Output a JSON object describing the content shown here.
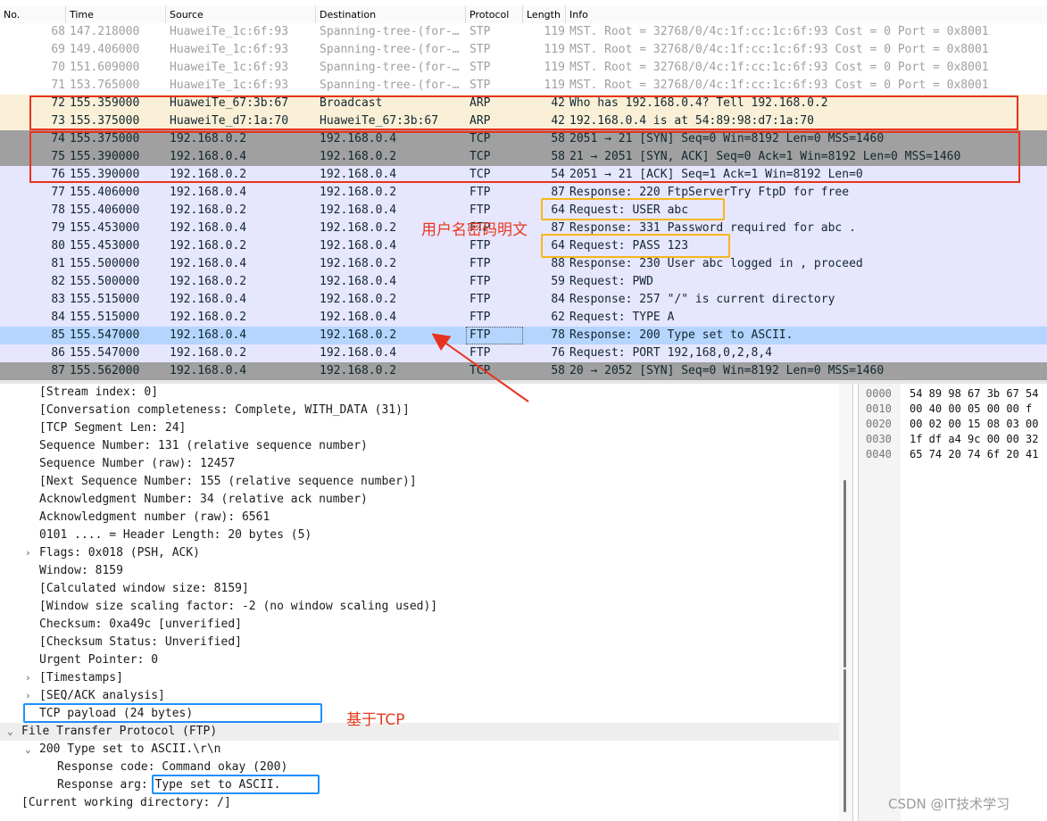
{
  "packet_list": {
    "columns": [
      "No.",
      "Time",
      "Source",
      "Destination",
      "Protocol",
      "Length",
      "Info"
    ],
    "rows": [
      {
        "no": "68",
        "time": "147.218000",
        "src": "HuaweiTe_1c:6f:93",
        "dst": "Spanning-tree-(for-…",
        "proto": "STP",
        "len": "119",
        "info": "MST. Root = 32768/0/4c:1f:cc:1c:6f:93  Cost = 0  Port = 0x8001",
        "style": "stp"
      },
      {
        "no": "69",
        "time": "149.406000",
        "src": "HuaweiTe_1c:6f:93",
        "dst": "Spanning-tree-(for-…",
        "proto": "STP",
        "len": "119",
        "info": "MST. Root = 32768/0/4c:1f:cc:1c:6f:93  Cost = 0  Port = 0x8001",
        "style": "stp"
      },
      {
        "no": "70",
        "time": "151.609000",
        "src": "HuaweiTe_1c:6f:93",
        "dst": "Spanning-tree-(for-…",
        "proto": "STP",
        "len": "119",
        "info": "MST. Root = 32768/0/4c:1f:cc:1c:6f:93  Cost = 0  Port = 0x8001",
        "style": "stp"
      },
      {
        "no": "71",
        "time": "153.765000",
        "src": "HuaweiTe_1c:6f:93",
        "dst": "Spanning-tree-(for-…",
        "proto": "STP",
        "len": "119",
        "info": "MST. Root = 32768/0/4c:1f:cc:1c:6f:93  Cost = 0  Port = 0x8001",
        "style": "stp"
      },
      {
        "no": "72",
        "time": "155.359000",
        "src": "HuaweiTe_67:3b:67",
        "dst": "Broadcast",
        "proto": "ARP",
        "len": "42",
        "info": "Who has 192.168.0.4? Tell 192.168.0.2",
        "style": "arp"
      },
      {
        "no": "73",
        "time": "155.375000",
        "src": "HuaweiTe_d7:1a:70",
        "dst": "HuaweiTe_67:3b:67",
        "proto": "ARP",
        "len": "42",
        "info": "192.168.0.4 is at 54:89:98:d7:1a:70",
        "style": "arp"
      },
      {
        "no": "74",
        "time": "155.375000",
        "src": "192.168.0.2",
        "dst": "192.168.0.4",
        "proto": "TCP",
        "len": "58",
        "info": "2051 → 21 [SYN] Seq=0 Win=8192 Len=0 MSS=1460",
        "style": "tcpdark"
      },
      {
        "no": "75",
        "time": "155.390000",
        "src": "192.168.0.4",
        "dst": "192.168.0.2",
        "proto": "TCP",
        "len": "58",
        "info": "21 → 2051 [SYN, ACK] Seq=0 Ack=1 Win=8192 Len=0 MSS=1460",
        "style": "tcpdark"
      },
      {
        "no": "76",
        "time": "155.390000",
        "src": "192.168.0.2",
        "dst": "192.168.0.4",
        "proto": "TCP",
        "len": "54",
        "info": "2051 → 21 [ACK] Seq=1 Ack=1 Win=8192 Len=0",
        "style": "tcp"
      },
      {
        "no": "77",
        "time": "155.406000",
        "src": "192.168.0.4",
        "dst": "192.168.0.2",
        "proto": "FTP",
        "len": "87",
        "info": "Response: 220 FtpServerTry FtpD for free",
        "style": "ftp"
      },
      {
        "no": "78",
        "time": "155.406000",
        "src": "192.168.0.2",
        "dst": "192.168.0.4",
        "proto": "FTP",
        "len": "64",
        "info": "Request: USER abc",
        "style": "ftp"
      },
      {
        "no": "79",
        "time": "155.453000",
        "src": "192.168.0.4",
        "dst": "192.168.0.2",
        "proto": "FTP",
        "len": "87",
        "info": "Response: 331 Password required for abc .",
        "style": "ftp"
      },
      {
        "no": "80",
        "time": "155.453000",
        "src": "192.168.0.2",
        "dst": "192.168.0.4",
        "proto": "FTP",
        "len": "64",
        "info": "Request: PASS 123",
        "style": "ftp"
      },
      {
        "no": "81",
        "time": "155.500000",
        "src": "192.168.0.4",
        "dst": "192.168.0.2",
        "proto": "FTP",
        "len": "88",
        "info": "Response: 230 User abc logged in , proceed",
        "style": "ftp"
      },
      {
        "no": "82",
        "time": "155.500000",
        "src": "192.168.0.2",
        "dst": "192.168.0.4",
        "proto": "FTP",
        "len": "59",
        "info": "Request: PWD",
        "style": "ftp"
      },
      {
        "no": "83",
        "time": "155.515000",
        "src": "192.168.0.4",
        "dst": "192.168.0.2",
        "proto": "FTP",
        "len": "84",
        "info": "Response: 257 \"/\" is current directory",
        "style": "ftp"
      },
      {
        "no": "84",
        "time": "155.515000",
        "src": "192.168.0.2",
        "dst": "192.168.0.4",
        "proto": "FTP",
        "len": "62",
        "info": "Request: TYPE A",
        "style": "ftp"
      },
      {
        "no": "85",
        "time": "155.547000",
        "src": "192.168.0.4",
        "dst": "192.168.0.2",
        "proto": "FTP",
        "len": "78",
        "info": "Response: 200 Type set to ASCII.",
        "style": "sel"
      },
      {
        "no": "86",
        "time": "155.547000",
        "src": "192.168.0.2",
        "dst": "192.168.0.4",
        "proto": "FTP",
        "len": "76",
        "info": "Request: PORT 192,168,0,2,8,4",
        "style": "ftp"
      },
      {
        "no": "87",
        "time": "155.562000",
        "src": "192.168.0.4",
        "dst": "192.168.0.2",
        "proto": "TCP",
        "len": "58",
        "info": "20 → 2052 [SYN] Seq=0 Win=8192 Len=0 MSS=1460",
        "style": "tcpdark"
      }
    ]
  },
  "annotations": {
    "credentials_note": "用户名密码明文",
    "tcp_note": "基于TCP"
  },
  "details": {
    "lines": [
      {
        "indent": 1,
        "expander": "",
        "text": "[Stream index: 0]"
      },
      {
        "indent": 1,
        "expander": "",
        "text": "[Conversation completeness: Complete, WITH_DATA (31)]"
      },
      {
        "indent": 1,
        "expander": "",
        "text": "[TCP Segment Len: 24]"
      },
      {
        "indent": 1,
        "expander": "",
        "text": "Sequence Number: 131    (relative sequence number)"
      },
      {
        "indent": 1,
        "expander": "",
        "text": "Sequence Number (raw): 12457"
      },
      {
        "indent": 1,
        "expander": "",
        "text": "[Next Sequence Number: 155    (relative sequence number)]"
      },
      {
        "indent": 1,
        "expander": "",
        "text": "Acknowledgment Number: 34    (relative ack number)"
      },
      {
        "indent": 1,
        "expander": "",
        "text": "Acknowledgment number (raw): 6561"
      },
      {
        "indent": 1,
        "expander": "",
        "text": "0101 .... = Header Length: 20 bytes (5)"
      },
      {
        "indent": 1,
        "expander": "›",
        "text": "Flags: 0x018 (PSH, ACK)"
      },
      {
        "indent": 1,
        "expander": "",
        "text": "Window: 8159"
      },
      {
        "indent": 1,
        "expander": "",
        "text": "[Calculated window size: 8159]"
      },
      {
        "indent": 1,
        "expander": "",
        "text": "[Window size scaling factor: -2 (no window scaling used)]"
      },
      {
        "indent": 1,
        "expander": "",
        "text": "Checksum: 0xa49c [unverified]"
      },
      {
        "indent": 1,
        "expander": "",
        "text": "[Checksum Status: Unverified]"
      },
      {
        "indent": 1,
        "expander": "",
        "text": "Urgent Pointer: 0"
      },
      {
        "indent": 1,
        "expander": "›",
        "text": "[Timestamps]"
      },
      {
        "indent": 1,
        "expander": "›",
        "text": "[SEQ/ACK analysis]"
      },
      {
        "indent": 1,
        "expander": "",
        "text": "TCP payload (24 bytes)"
      },
      {
        "indent": 0,
        "expander": "⌄",
        "text": "File Transfer Protocol (FTP)",
        "highlight": true
      },
      {
        "indent": 1,
        "expander": "⌄",
        "text": "200 Type set to ASCII.\\r\\n"
      },
      {
        "indent": 2,
        "expander": "",
        "text": "Response code: Command okay (200)"
      },
      {
        "indent": 2,
        "expander": "",
        "text": "Response arg: Type set to ASCII."
      },
      {
        "indent": 0,
        "expander": "",
        "text": "[Current working directory: /]"
      }
    ]
  },
  "bytes": {
    "lines": [
      {
        "off": "0000",
        "hex": "54 89 98 67 3b 67 54"
      },
      {
        "off": "0010",
        "hex": "00 40 00 05 00 00 f"
      },
      {
        "off": "0020",
        "hex": "00 02 00 15 08 03 00"
      },
      {
        "off": "0030",
        "hex": "1f df a4 9c 00 00 32"
      },
      {
        "off": "0040",
        "hex": "65 74 20 74 6f 20 41"
      }
    ]
  },
  "watermark": "CSDN @IT技术学习",
  "colors": {
    "red": "#e8331f",
    "orange": "#f5b622",
    "blue": "#1e90ff",
    "selected": "#b5d5ff",
    "arp": "#faf0d7",
    "tcp_light": "#e7e6ff",
    "tcp_dark": "#a0a0a0"
  }
}
